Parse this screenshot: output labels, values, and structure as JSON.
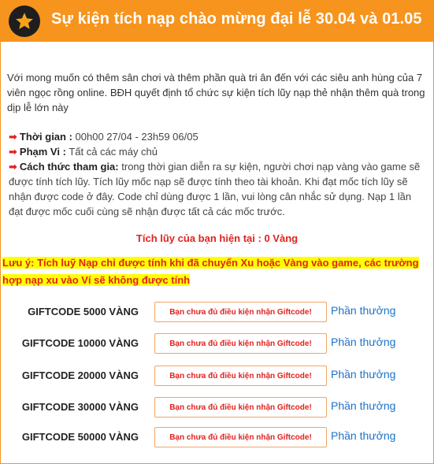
{
  "header": {
    "title": "Sự kiện tích nạp chào mừng đại lễ 30.04 và 01.05",
    "icon": "star-icon",
    "color": "#f7941d"
  },
  "intro": "Với mong muốn có thêm sân chơi và thêm phần quà tri ân đến với các siêu anh hùng của 7 viên ngọc rồng online. BĐH quyết định tổ chức sự kiện tích lũy nạp thẻ nhận thêm quà trong dịp lễ lớn này",
  "details": {
    "time_label": "Thời gian :",
    "time_value": "00h00 27/04 - 23h59 06/05",
    "scope_label": "Phạm Vi :",
    "scope_value": "Tất cả các máy chủ",
    "method_label": "Cách thức tham gia:",
    "method_value": "trong thời gian diễn ra sự kiện, người chơi nạp vàng vào game sẽ được tính tích lũy. Tích lũy mốc nạp sẽ được tính theo tài khoản. Khi đạt mốc tích lũy sẽ nhận được code ở đây. Code chỉ dùng được 1 lần, vui lòng cân nhắc sử dụng. Nạp 1 lần đạt được mốc cuối cùng sẽ nhận được tất cả các mốc trước."
  },
  "total_text": "Tích lũy của bạn hiện tại : 0 Vàng",
  "note": "Lưu ý: Tích luỹ Nạp chỉ được tính khi đã chuyển Xu hoặc Vàng vào game, các trường hợp nạp xu vào Ví sẽ không được tính",
  "giftcodes": [
    {
      "name": "GIFTCODE 5000 VÀNG",
      "button": "Bạn chưa đủ điều kiện nhận Giftcode!",
      "reward": "Phần thưởng"
    },
    {
      "name": "GIFTCODE 10000 VÀNG",
      "button": "Bạn chưa đủ điều kiện nhận Giftcode!",
      "reward": "Phần thưởng"
    },
    {
      "name": "GIFTCODE 20000 VÀNG",
      "button": "Bạn chưa đủ điều kiện nhận Giftcode!",
      "reward": "Phần thưởng"
    },
    {
      "name": "GIFTCODE 30000 VÀNG",
      "button": "Bạn chưa đủ điều kiện nhận Giftcode!",
      "reward": "Phần thưởng"
    },
    {
      "name": "GIFTCODE 50000 VÀNG",
      "button": "Bạn chưa đủ điều kiện nhận Giftcode!",
      "reward": "Phần thưởng"
    }
  ],
  "colors": {
    "accent": "#f7941d",
    "alert": "#e0231f",
    "link": "#1d72c9",
    "highlight": "#ffff00"
  }
}
